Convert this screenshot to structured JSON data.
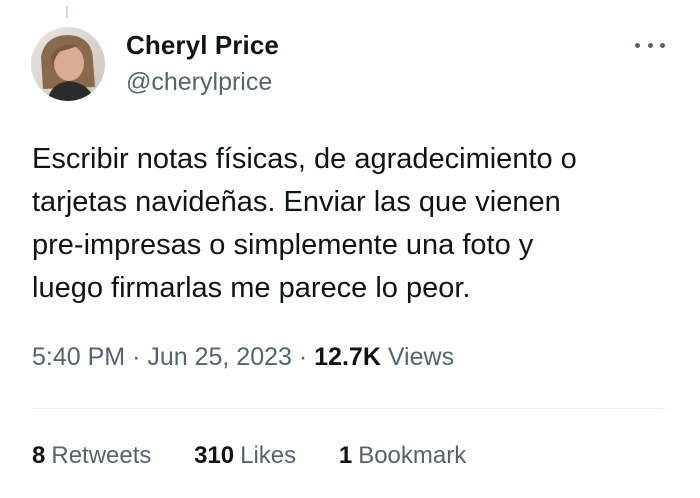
{
  "author": {
    "name": "Cheryl Price",
    "handle": "@cherylprice"
  },
  "tweet": {
    "text": "Escribir notas físicas, de agradecimiento o\ntarjetas navideñas. Enviar las que vienen\npre-impresas o simplemente una foto y\nluego firmarlas me parece lo peor."
  },
  "meta": {
    "time": "5:40 PM",
    "separator1": "·",
    "date": "Jun 25, 2023",
    "separator2": "·",
    "views_count": "12.7K",
    "views_label": "Views"
  },
  "stats": {
    "retweets_count": "8",
    "retweets_label": "Retweets",
    "likes_count": "310",
    "likes_label": "Likes",
    "bookmarks_count": "1",
    "bookmarks_label": "Bookmark"
  },
  "icons": {
    "more": "more-horizontal-icon"
  },
  "colors": {
    "text_primary": "#0f1419",
    "text_secondary": "#536471",
    "divider": "#eff3f4"
  }
}
